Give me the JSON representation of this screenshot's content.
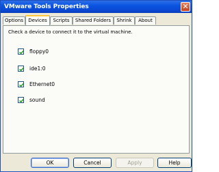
{
  "window": {
    "title": "VMware Tools Properties",
    "close_glyph": "✕"
  },
  "tabs": [
    {
      "label": "Options",
      "active": false
    },
    {
      "label": "Devices",
      "active": true
    },
    {
      "label": "Scripts",
      "active": false
    },
    {
      "label": "Shared Folders",
      "active": false
    },
    {
      "label": "Shrink",
      "active": false
    },
    {
      "label": "About",
      "active": false
    }
  ],
  "devices_panel": {
    "description": "Check a device to connect it to the virtual machine.",
    "devices": [
      {
        "label": "floppy0",
        "checked": true
      },
      {
        "label": "ide1:0",
        "checked": true
      },
      {
        "label": "Ethernet0",
        "checked": true
      },
      {
        "label": "sound",
        "checked": true
      }
    ]
  },
  "buttons": {
    "ok": "OK",
    "cancel": "Cancel",
    "apply": "Apply",
    "help": "Help"
  },
  "colors": {
    "title_bar": "#0a54e0",
    "active_tab_accent": "#ffc83c",
    "close_button": "#c4421e"
  }
}
